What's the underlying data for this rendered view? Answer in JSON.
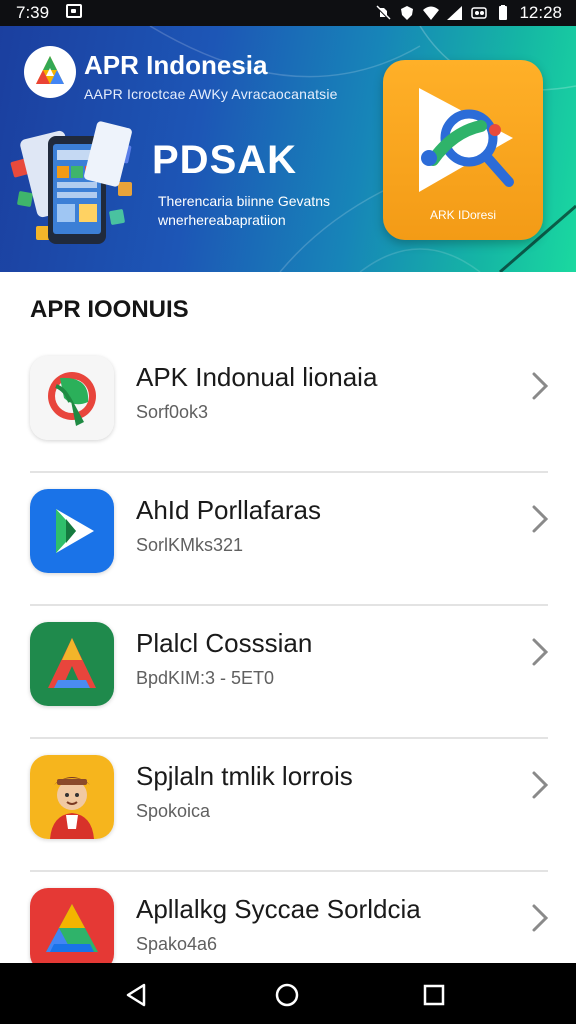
{
  "status_bar": {
    "time_left": "7:39",
    "time_right": "12:28",
    "icons": [
      "image-notification-icon",
      "mute-icon",
      "shield-icon",
      "wifi-icon",
      "signal-icon",
      "data-icon",
      "battery-icon"
    ]
  },
  "banner": {
    "brand_title": "APR Indonesia",
    "brand_subtitle": "AAPR Icroctcae AWKy Avracaocanatsie",
    "headline": "PDSAK",
    "description_line1": "Therencaria biinne Gevatns",
    "description_line2": "wnerhereabapratiion",
    "app_tile_label": "ARK IDoresi"
  },
  "section": {
    "title": "APR IOONUIS"
  },
  "apps": [
    {
      "title": "APK Indonual lionaia",
      "subtitle": "Sorf0ok3",
      "icon": "green-leaf-app-icon"
    },
    {
      "title": "AhId Porllafaras",
      "subtitle": "SorlKMks321",
      "icon": "blue-play-app-icon"
    },
    {
      "title": "Plalcl Cosssian",
      "subtitle": "BpdKIM:3 - 5ET0",
      "icon": "green-a-app-icon"
    },
    {
      "title": "Spjlaln tmlik lorrois",
      "subtitle": "Spokoica",
      "icon": "character-app-icon"
    },
    {
      "title": "Apllalkg Syccae Sorldcia",
      "subtitle": "Spako4a6",
      "icon": "red-triangle-app-icon"
    }
  ],
  "nav": {
    "icons": [
      "back-icon",
      "home-icon",
      "recents-icon"
    ]
  },
  "colors": {
    "banner_start": "#1b3f9f",
    "banner_end": "#1ad9a0",
    "tile_orange": "#f39b16",
    "text_primary": "#1a1a1a",
    "text_secondary": "#606060"
  }
}
